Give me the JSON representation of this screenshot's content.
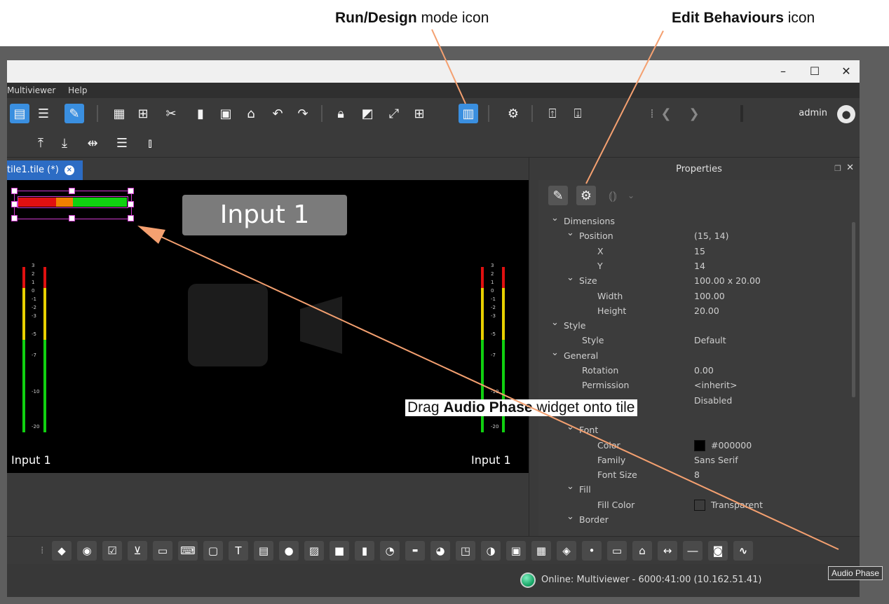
{
  "callouts": {
    "run_design_bold": "Run/Design",
    "run_design_rest": " mode icon",
    "edit_behaviours_bold": "Edit Behaviours",
    "edit_behaviours_rest": " icon",
    "drag_prefix": "Drag ",
    "drag_bold": "Audio Phase",
    "drag_rest": " widget onto tile"
  },
  "window": {
    "minimize": "–",
    "maximize": "☐",
    "close": "✕"
  },
  "menu": [
    "Multiviewer",
    "Help"
  ],
  "toolbar": {
    "user": "admin"
  },
  "tab": {
    "label": "tile1.tile (*)"
  },
  "canvas": {
    "input_box_text": "Input 1",
    "left_label": "Input 1",
    "right_label": "Input 1",
    "meter_scale": [
      "3",
      "2",
      "1",
      "0",
      "-1",
      "-2",
      "-3",
      "-5",
      "-7",
      "-10",
      "-20"
    ]
  },
  "properties": {
    "title": "Properties",
    "rows": [
      {
        "indent": 0,
        "arrow": true,
        "label": "Dimensions",
        "value": ""
      },
      {
        "indent": 1,
        "arrow": true,
        "label": "Position",
        "value": "(15, 14)"
      },
      {
        "indent": 2,
        "arrow": false,
        "label": "X",
        "value": "15"
      },
      {
        "indent": 2,
        "arrow": false,
        "label": "Y",
        "value": "14"
      },
      {
        "indent": 1,
        "arrow": true,
        "label": "Size",
        "value": "100.00 x 20.00"
      },
      {
        "indent": 2,
        "arrow": false,
        "label": "Width",
        "value": "100.00"
      },
      {
        "indent": 2,
        "arrow": false,
        "label": "Height",
        "value": "20.00"
      },
      {
        "indent": 0,
        "arrow": true,
        "label": "Style",
        "value": ""
      },
      {
        "indent": 1,
        "arrow": false,
        "label": "Style",
        "value": "Default"
      },
      {
        "indent": 0,
        "arrow": true,
        "label": "General",
        "value": ""
      },
      {
        "indent": 1,
        "arrow": false,
        "label": "Rotation",
        "value": "0.00"
      },
      {
        "indent": 1,
        "arrow": false,
        "label": "Permission",
        "value": "<inherit>"
      },
      {
        "indent": 1,
        "arrow": false,
        "label": "",
        "value": "Disabled"
      },
      {
        "indent": 0,
        "arrow": false,
        "label": "",
        "value": ""
      },
      {
        "indent": 1,
        "arrow": true,
        "label": "Font",
        "value": ""
      },
      {
        "indent": 2,
        "arrow": false,
        "label": "Color",
        "value": "#000000",
        "swatch": "#000000"
      },
      {
        "indent": 2,
        "arrow": false,
        "label": "Family",
        "value": "Sans Serif"
      },
      {
        "indent": 2,
        "arrow": false,
        "label": "Font Size",
        "value": "8"
      },
      {
        "indent": 1,
        "arrow": true,
        "label": "Fill",
        "value": ""
      },
      {
        "indent": 2,
        "arrow": false,
        "label": "Fill Color",
        "value": "Transparent",
        "swatch": "transparent"
      },
      {
        "indent": 1,
        "arrow": true,
        "label": "Border",
        "value": ""
      }
    ]
  },
  "status": {
    "text": "Online: Multiviewer - 6000:41:00 (10.162.51.41)"
  },
  "tooltip": "Audio Phase",
  "colors": {
    "accent": "#3a8fe0",
    "callout_line": "#f4a070",
    "meter_red": "#e01010",
    "meter_orange": "#f08000",
    "meter_green": "#10d010",
    "meter_yellow": "#e8d000"
  }
}
